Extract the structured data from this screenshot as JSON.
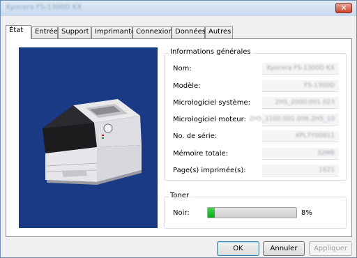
{
  "window": {
    "title": "Kyocera FS-1300D KX",
    "close_glyph": "✕"
  },
  "tabs": [
    {
      "label": "État",
      "active": true
    },
    {
      "label": "Entrée"
    },
    {
      "label": "Support"
    },
    {
      "label": "Imprimante"
    },
    {
      "label": "Connexion"
    },
    {
      "label": "Données"
    },
    {
      "label": "Autres"
    }
  ],
  "image_panel": {
    "background": "#1a3a86",
    "icon": "printer-icon"
  },
  "info": {
    "group_label": "Informations générales",
    "rows": [
      {
        "label": "Nom:",
        "value": "Kyocera FS-1300D KX"
      },
      {
        "label": "Modèle:",
        "value": "FS-1300D"
      },
      {
        "label": "Micrologiciel système:",
        "value": "2H5_2000.001.023"
      },
      {
        "label": "Micrologiciel moteur:",
        "value": "2H5_1100.001.006.2H5_10"
      },
      {
        "label": "No. de série:",
        "value": "XPL7Y00811"
      },
      {
        "label": "Mémoire totale:",
        "value": "32MB"
      },
      {
        "label": "Page(s) imprimée(s):",
        "value": "1621"
      }
    ]
  },
  "toner": {
    "group_label": "Toner",
    "label": "Noir:",
    "percent_text": "8%",
    "level_percent": 8,
    "fill_color": "#1dbb2e"
  },
  "buttons": {
    "ok": "OK",
    "cancel": "Annuler",
    "apply": "Appliquer"
  }
}
